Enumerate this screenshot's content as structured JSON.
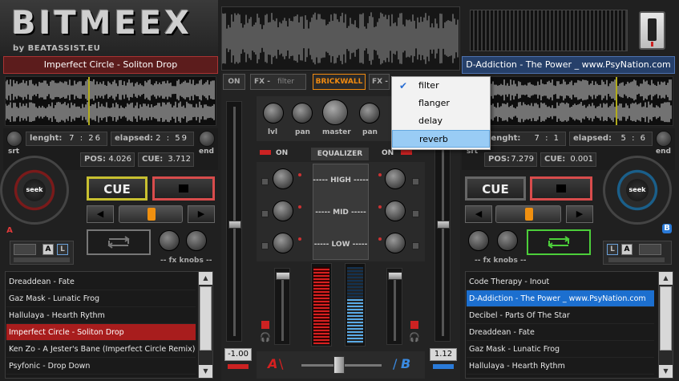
{
  "logo": {
    "name": "BITMEEX",
    "byline": "by BEATASSIST.EU"
  },
  "deckA": {
    "title": "Imperfect Circle - Soliton Drop",
    "length_label": "lenght:",
    "length": "7 : 26",
    "elapsed_label": "elapsed:",
    "elapsed": "2 : 59",
    "pos_label": "POS:",
    "pos": "4.026",
    "cue_label": "CUE:",
    "cue": "3.712",
    "srt_label": "srt",
    "end_label": "end",
    "seek_label": "seek",
    "cue_button": "CUE",
    "letter": "A",
    "ab_a": "A",
    "ab_l": "L",
    "fx_knobs": "-- fx knobs --",
    "pitch_value": "-1.00",
    "playlist": [
      "Dreaddean - Fate",
      "Gaz Mask - Lunatic Frog",
      "Hallulaya - Hearth Rythm",
      "Imperfect Circle - Soliton Drop",
      "Ken Zo - A Jester's Bane (Imperfect Circle Remix)",
      "Psyfonic - Drop Down"
    ],
    "selected_index": 3
  },
  "deckB": {
    "title": "D-Addiction - The Power _ www.PsyNation.com",
    "length_label": "lenght:",
    "length": "7 : 1",
    "elapsed_label": "elapsed:",
    "elapsed": "5 : 6",
    "pos_label": "POS:",
    "pos": "7.279",
    "cue_label": "CUE:",
    "cue": "0.001",
    "srt_label": "srt",
    "end_label": "end",
    "seek_label": "seek",
    "cue_button": "CUE",
    "letter": "B",
    "ab_l": "L",
    "ab_a": "A",
    "fx_knobs": "-- fx knobs --",
    "pitch_value": "1.12",
    "playlist": [
      "Code Therapy - Inout",
      "D-Addiction - The Power _ www.PsyNation.com",
      "Decibel - Parts Of The Star",
      "Dreaddean - Fate",
      "Gaz Mask - Lunatic Frog",
      "Hallulaya - Hearth Rythm"
    ],
    "selected_index": 1
  },
  "mixer": {
    "on_left": "ON",
    "fx_left": "FX -",
    "fx_left_value": "filter",
    "brickwall": "BRICKWALL",
    "fx_right": "FX -",
    "knob_lvl": "lvl",
    "knob_pan_l": "pan",
    "knob_master": "master",
    "knob_pan_r": "pan",
    "on_a": "ON",
    "equalizer": "EQUALIZER",
    "on_b": "ON",
    "eq_high": "----- HIGH -----",
    "eq_mid": "----- MID -----",
    "eq_low": "----- LOW -----",
    "cross_a": "A",
    "cross_b": "B"
  },
  "fx_menu": {
    "items": [
      "filter",
      "flanger",
      "delay",
      "reverb"
    ],
    "checked_index": 0,
    "highlighted_index": 3
  },
  "colors": {
    "deckA": "#a81d1d",
    "deckB": "#1c6fcf",
    "cue_border": "#c8c030",
    "play_border": "#d84c4c",
    "loop_b": "#4ccf3a",
    "brickwall": "#f08a10"
  }
}
